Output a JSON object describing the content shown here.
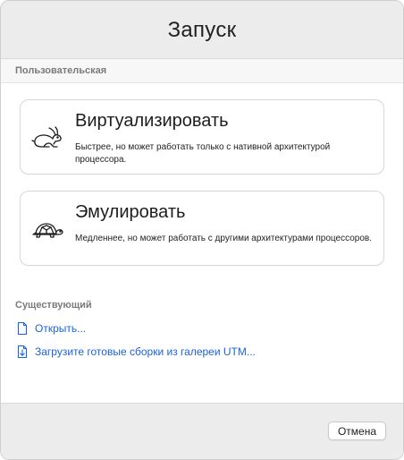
{
  "dialog": {
    "title": "Запуск"
  },
  "custom_section": {
    "label": "Пользовательская"
  },
  "options": [
    {
      "title": "Виртуализировать",
      "description": "Быстрее, но может работать только с нативной архитектурой процессора.",
      "icon": "rabbit-icon"
    },
    {
      "title": "Эмулировать",
      "description": "Медленнее, но может работать с другими архитектурами процессоров.",
      "icon": "turtle-icon"
    }
  ],
  "existing_section": {
    "label": "Существующий",
    "links": [
      {
        "label": "Открыть...",
        "icon": "document-icon"
      },
      {
        "label": "Загрузите готовые сборки из галереи UTM...",
        "icon": "document-download-icon"
      }
    ]
  },
  "footer": {
    "cancel_label": "Отмена"
  },
  "colors": {
    "accent": "#1a63d8",
    "header_bg": "#ececec",
    "card_border": "#d8d8d8"
  }
}
